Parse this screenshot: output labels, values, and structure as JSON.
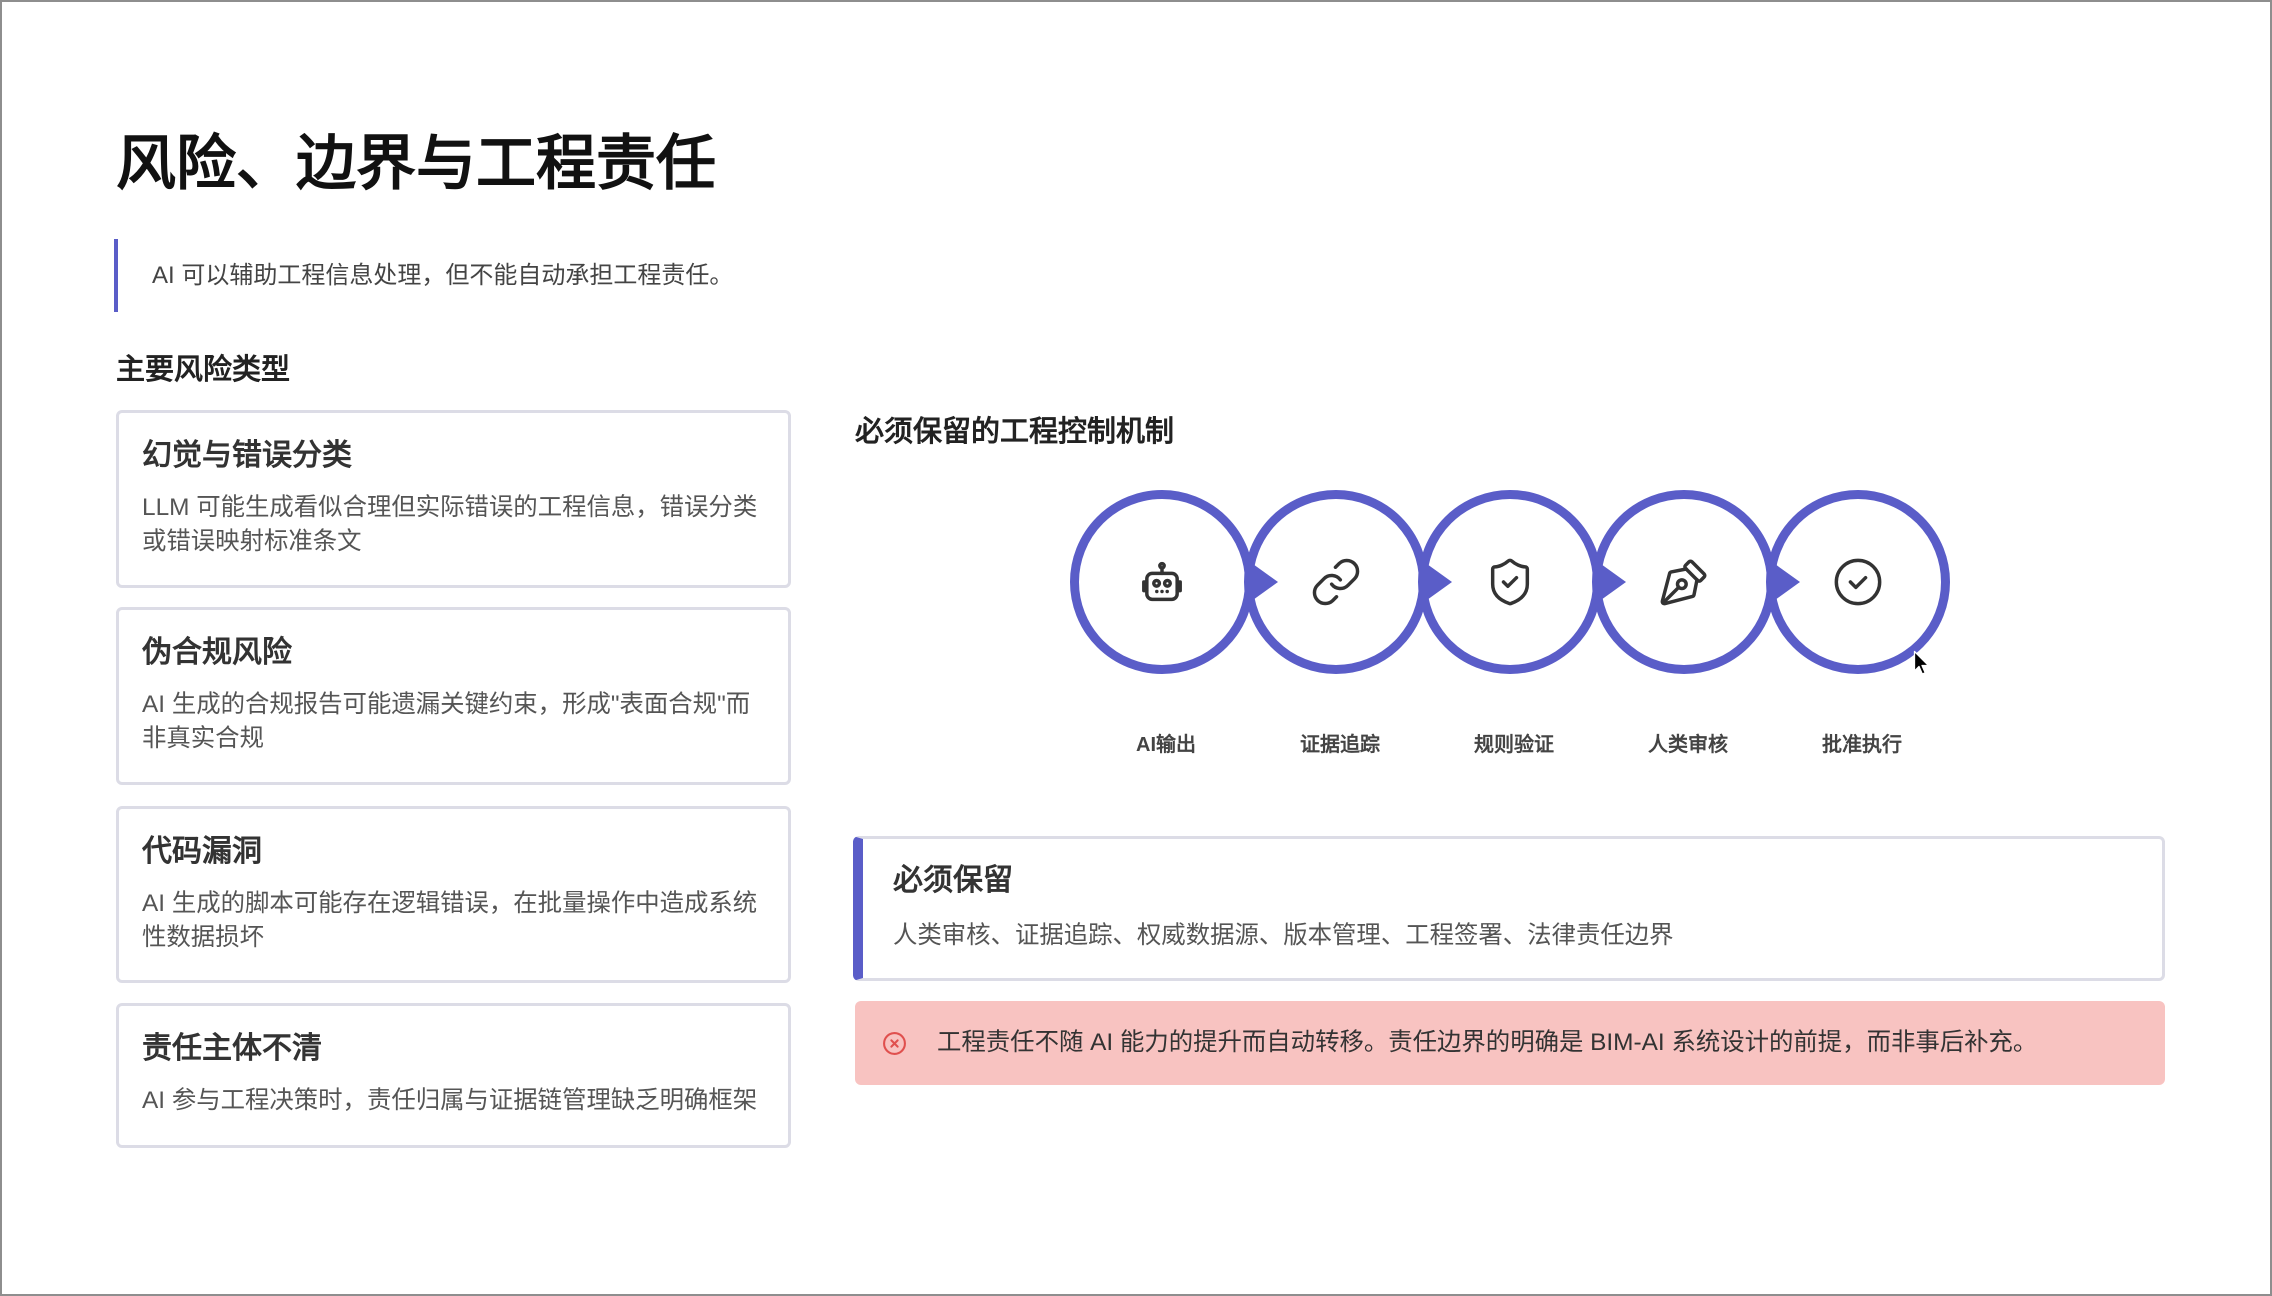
{
  "slide": {
    "title": "风险、边界与工程责任",
    "quote": "AI 可以辅助工程信息处理，但不能自动承担工程责任。"
  },
  "risks": {
    "heading": "主要风险类型",
    "items": [
      {
        "title": "幻觉与错误分类",
        "body": "LLM 可能生成看似合理但实际错误的工程信息，错误分类或错误映射标准条文"
      },
      {
        "title": "伪合规风险",
        "body": "AI 生成的合规报告可能遗漏关键约束，形成\"表面合规\"而非真实合规"
      },
      {
        "title": "代码漏洞",
        "body": "AI 生成的脚本可能存在逻辑错误，在批量操作中造成系统性数据损坏"
      },
      {
        "title": "责任主体不清",
        "body": "AI 参与工程决策时，责任归属与证据链管理缺乏明确框架"
      }
    ]
  },
  "controls": {
    "heading": "必须保留的工程控制机制",
    "steps": [
      {
        "label": "AI输出",
        "icon": "robot-icon"
      },
      {
        "label": "证据追踪",
        "icon": "link-icon"
      },
      {
        "label": "规则验证",
        "icon": "shield-check-icon"
      },
      {
        "label": "人类审核",
        "icon": "pen-nib-icon"
      },
      {
        "label": "批准执行",
        "icon": "check-circle-icon"
      }
    ]
  },
  "retain": {
    "title": "必须保留",
    "body": "人类审核、证据追踪、权威数据源、版本管理、工程签署、法律责任边界"
  },
  "alert": {
    "icon": "circle-x-icon",
    "text": "工程责任不随 AI 能力的提升而自动转移。责任边界的明确是 BIM-AI 系统设计的前提，而非事后补充。"
  },
  "colors": {
    "accent": "#5a5dc8",
    "alert_bg": "#f8c3c1",
    "alert_icon": "#e0504e"
  }
}
